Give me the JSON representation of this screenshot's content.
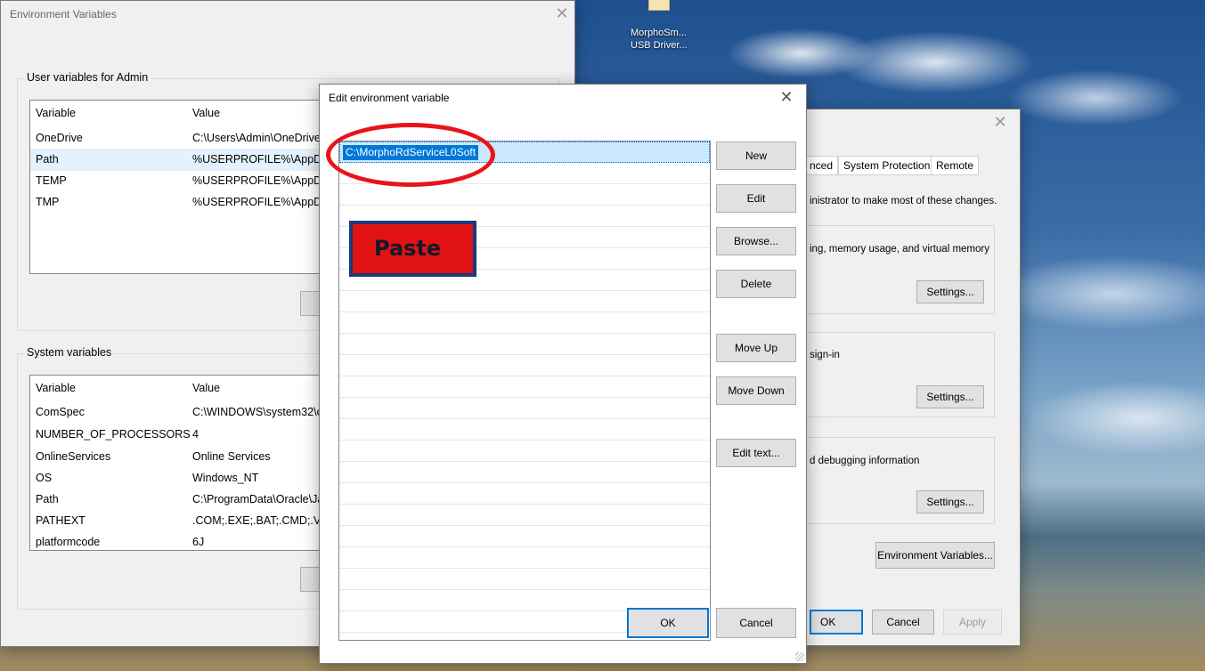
{
  "desktop": {
    "icon_label_line1": "MorphoSm...",
    "icon_label_line2": "USB Driver..."
  },
  "env_window": {
    "title": "Environment Variables",
    "user_group_label": "User variables for Admin",
    "system_group_label": "System variables",
    "col_variable": "Variable",
    "col_value": "Value",
    "user_vars": [
      {
        "name": "OneDrive",
        "value": "C:\\Users\\Admin\\OneDrive"
      },
      {
        "name": "Path",
        "value": "%USERPROFILE%\\AppData\\"
      },
      {
        "name": "TEMP",
        "value": "%USERPROFILE%\\AppData\\"
      },
      {
        "name": "TMP",
        "value": "%USERPROFILE%\\AppData\\"
      }
    ],
    "system_vars": [
      {
        "name": "ComSpec",
        "value": "C:\\WINDOWS\\system32\\c"
      },
      {
        "name": "NUMBER_OF_PROCESSORS",
        "value": "4"
      },
      {
        "name": "OnlineServices",
        "value": "Online Services"
      },
      {
        "name": "OS",
        "value": "Windows_NT"
      },
      {
        "name": "Path",
        "value": "C:\\ProgramData\\Oracle\\Ja"
      },
      {
        "name": "PATHEXT",
        "value": ".COM;.EXE;.BAT;.CMD;.VBS"
      },
      {
        "name": "platformcode",
        "value": "6J"
      }
    ]
  },
  "edit_window": {
    "title": "Edit environment variable",
    "entry_value": "C:\\MorphoRdServiceL0Soft",
    "buttons": {
      "new": "New",
      "edit": "Edit",
      "browse": "Browse...",
      "delete": "Delete",
      "move_up": "Move Up",
      "move_down": "Move Down",
      "edit_text": "Edit text...",
      "ok": "OK",
      "cancel": "Cancel"
    }
  },
  "sysprops_window": {
    "tabs": [
      "nced",
      "System Protection",
      "Remote"
    ],
    "admin_note": "inistrator to make most of these changes.",
    "perf_text": "ing, memory usage, and virtual memory",
    "profile_text": "sign-in",
    "startup_text": "d debugging information",
    "settings_label": "Settings...",
    "env_vars_button": "Environment Variables...",
    "ok": "OK",
    "cancel": "Cancel",
    "apply": "Apply"
  },
  "annotation": {
    "paste_label": "Paste",
    "highlight_color": "#e8141a"
  },
  "close_glyph": "✕"
}
